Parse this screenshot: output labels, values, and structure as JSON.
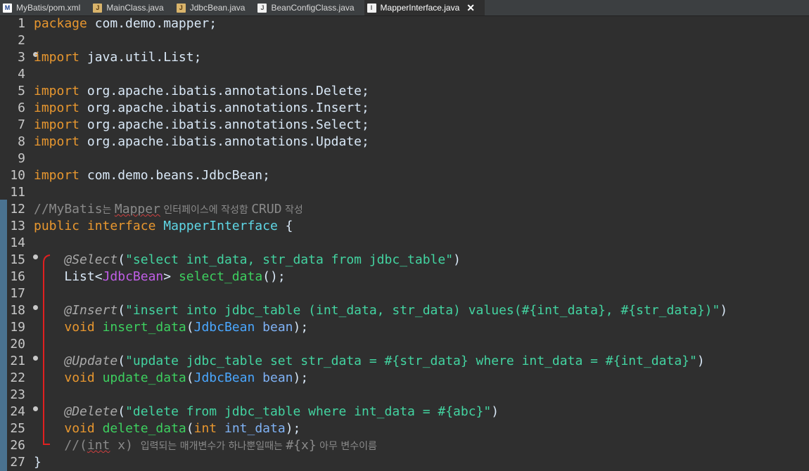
{
  "tabs": [
    {
      "label": "MyBatis/pom.xml",
      "icon": "maven-file-icon",
      "active": false
    },
    {
      "label": "MainClass.java",
      "icon": "java-file-icon",
      "active": false
    },
    {
      "label": "JdbcBean.java",
      "icon": "java-file-icon",
      "active": false
    },
    {
      "label": "BeanConfigClass.java",
      "icon": "java-file-icon",
      "active": false
    },
    {
      "label": "MapperInterface.java",
      "icon": "java-interface-icon",
      "active": true
    }
  ],
  "line_numbers": [
    "1",
    "2",
    "3",
    "4",
    "5",
    "6",
    "7",
    "8",
    "9",
    "10",
    "11",
    "12",
    "13",
    "14",
    "15",
    "16",
    "17",
    "18",
    "19",
    "20",
    "21",
    "22",
    "23",
    "24",
    "25",
    "26",
    "27"
  ],
  "code": {
    "l1": {
      "kw": "package",
      "rest": " com.demo.mapper;"
    },
    "l3": {
      "kw": "import",
      "rest": " java.util.List;"
    },
    "l5": {
      "kw": "import",
      "rest": " org.apache.ibatis.annotations.Delete;"
    },
    "l6": {
      "kw": "import",
      "rest": " org.apache.ibatis.annotations.Insert;"
    },
    "l7": {
      "kw": "import",
      "rest": " org.apache.ibatis.annotations.Select;"
    },
    "l8": {
      "kw": "import",
      "rest": " org.apache.ibatis.annotations.Update;"
    },
    "l10": {
      "kw": "import",
      "rest": " com.demo.beans.JdbcBean;"
    },
    "l12": {
      "p1": "//MyBatis",
      "p2": "는 ",
      "p3": "Mapper",
      "p4": " 인터페이스에 작성함 ",
      "p5": "CRUD",
      "p6": " 작성"
    },
    "l13": {
      "kw1": "public",
      "kw2": "interface",
      "name": "MapperInterface",
      "brace": " {"
    },
    "l15": {
      "ann": "@Select",
      "open": "(",
      "str": "\"select int_data, str_data from jdbc_table\"",
      "close": ")"
    },
    "l16": {
      "t1": "List",
      "lt": "<",
      "t2": "JdbcBean",
      "gt": ">",
      "m": "select_data",
      "rest": "();"
    },
    "l18": {
      "ann": "@Insert",
      "open": "(",
      "str": "\"insert into jdbc_table (int_data, str_data) values(#{int_data}, #{str_data})\"",
      "close": ")"
    },
    "l19": {
      "kw": "void",
      "m": "insert_data",
      "open": "(",
      "t": "JdbcBean",
      "p": "bean",
      "close": ");"
    },
    "l21": {
      "ann": "@Update",
      "open": "(",
      "str": "\"update jdbc_table set str_data = #{str_data} where int_data = #{int_data}\"",
      "close": ")"
    },
    "l22": {
      "kw": "void",
      "m": "update_data",
      "open": "(",
      "t": "JdbcBean",
      "p": "bean",
      "close": ");"
    },
    "l24": {
      "ann": "@Delete",
      "open": "(",
      "str": "\"delete from jdbc_table where int_data = #{abc}\"",
      "close": ")"
    },
    "l25": {
      "kw": "void",
      "m": "delete_data",
      "open": "(",
      "kw2": "int",
      "p": "int_data",
      "close": ");"
    },
    "l26": {
      "p1": "//(",
      "p2": "int",
      "p3": " x) ",
      "p4": "입력되는 매개변수가 하나뿐일때는 ",
      "p5": "#{x}",
      "p6": " 아무 변수이름"
    },
    "l27": {
      "brace": "}"
    }
  },
  "colors": {
    "keyword": "#e8972f",
    "string": "#43d4a1",
    "method": "#3dd05f",
    "type_param": "#c05ee6",
    "class_ref": "#4aa7ff",
    "annotation": "#a9a9a9",
    "comment": "#8a8a8a",
    "bracket_annotation": "#e02020"
  }
}
